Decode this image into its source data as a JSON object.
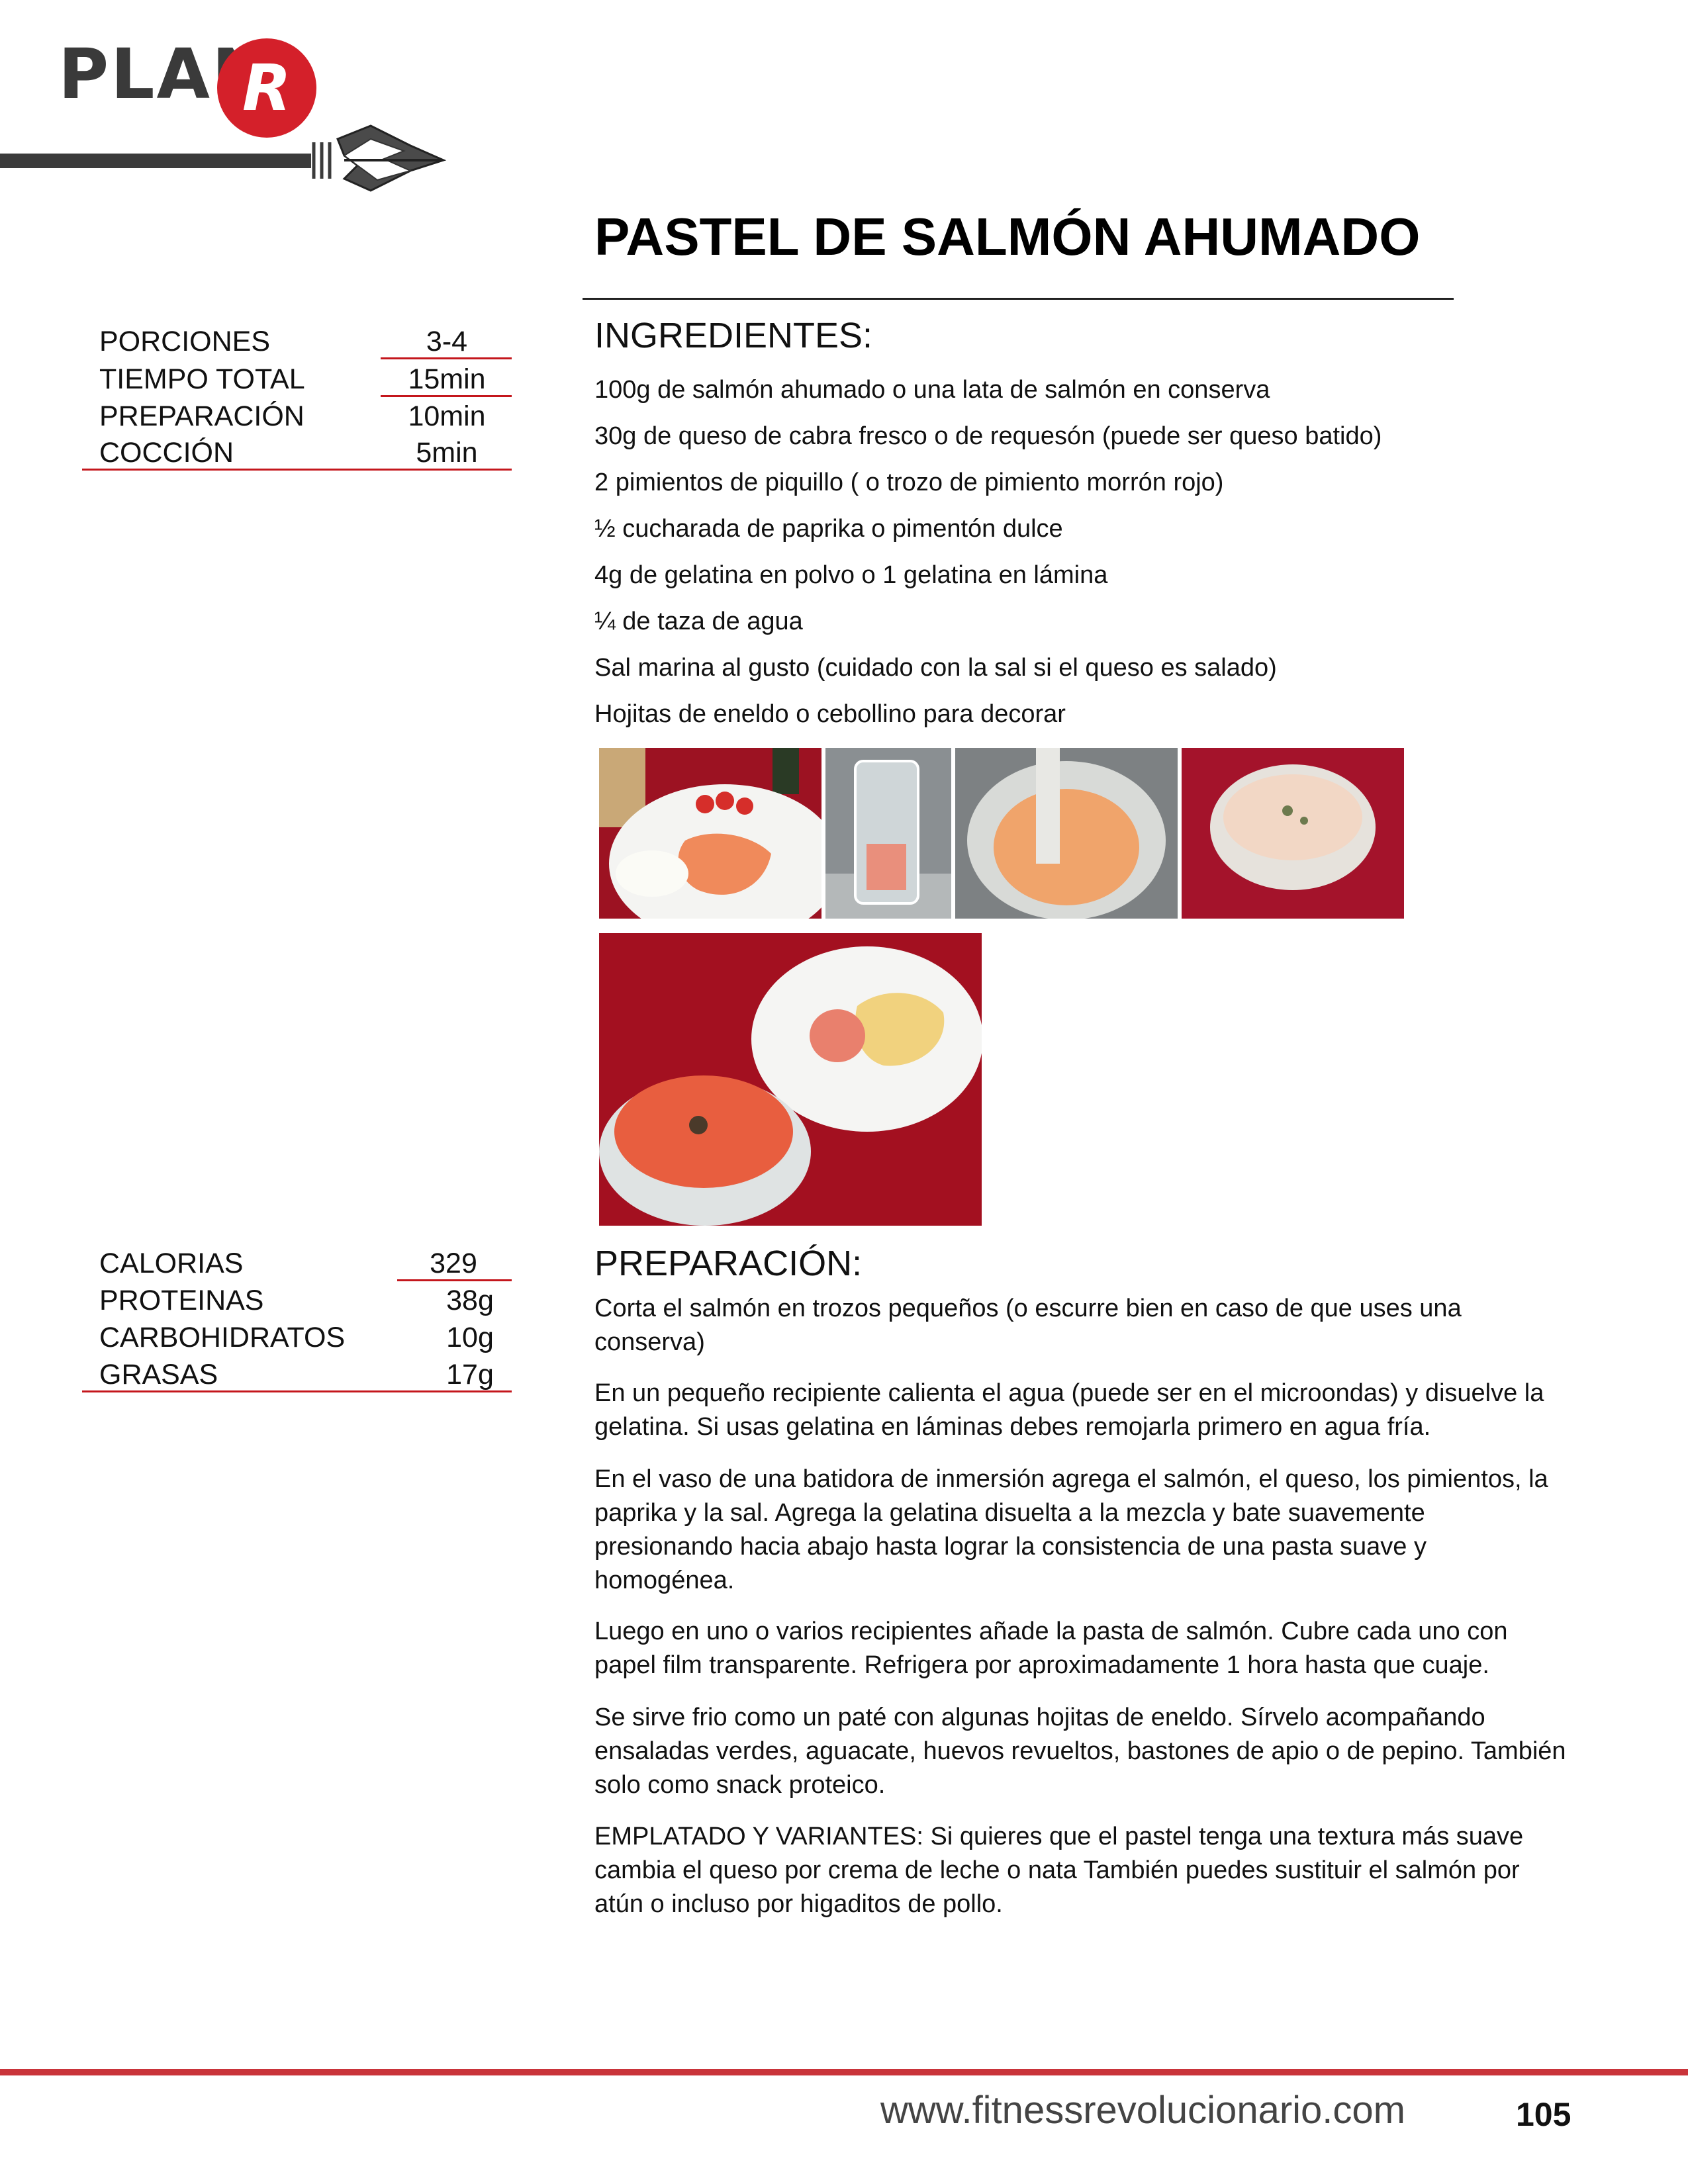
{
  "logo": {
    "word": "PLAN",
    "letter": "R"
  },
  "title": "PASTEL DE SALMÓN AHUMADO",
  "ingredients_heading": "INGREDIENTES:",
  "ingredients": [
    "100g de salmón ahumado o una lata de salmón en conserva",
    "30g de queso de cabra fresco o de requesón (puede ser queso batido)",
    "2 pimientos de piquillo ( o trozo de pimiento morrón rojo)",
    "½ cucharada de paprika o pimentón dulce",
    "4g de gelatina en polvo o 1 gelatina en lámina",
    "¼  de taza de agua",
    "Sal marina al gusto  (cuidado con la sal si el queso es salado)",
    "Hojitas de eneldo o cebollino para decorar"
  ],
  "recipe_info": [
    {
      "label": "PORCIONES",
      "value": "3-4"
    },
    {
      "label": "TIEMPO TOTAL",
      "value": "15min"
    },
    {
      "label": "PREPARACIÓN",
      "value": "10min"
    },
    {
      "label": "COCCIÓN",
      "value": "5min"
    }
  ],
  "nutrition": [
    {
      "label": "CALORIAS",
      "value": "329"
    },
    {
      "label": "PROTEINAS",
      "value": "38g"
    },
    {
      "label": "CARBOHIDRATOS",
      "value": "10g"
    },
    {
      "label": "GRASAS",
      "value": "17g"
    }
  ],
  "preparation_heading": "PREPARACIÓN:",
  "preparation": [
    "Corta el salmón en trozos pequeños (o escurre bien en caso de que uses una conserva)",
    "En un pequeño recipiente calienta el agua (puede ser en el microondas) y disuelve la gelatina.  Si usas gelatina en láminas debes remojarla primero  en agua fría.",
    "En el vaso de una batidora de inmersión agrega el salmón, el queso, los pimientos, la paprika y la sal. Agrega la gelatina disuelta a la mezcla y bate suavemente presionando hacia abajo hasta lograr la consistencia de una pasta suave y homogénea.",
    "Luego en uno o varios recipientes añade la pasta de salmón. Cubre cada uno con papel film transparente. Refrigera por aproximadamente 1 hora hasta que cuaje.",
    "Se sirve frio como un paté con algunas hojitas de eneldo. Sírvelo acompañando ensaladas verdes, aguacate, huevos  revueltos, bastones de apio o de pepino. También solo como snack proteico.",
    "EMPLATADO Y VARIANTES: Si quieres que el pastel tenga una textura más suave cambia el queso por crema de leche o nata También puedes sustituir el salmón por atún o incluso por higaditos de pollo."
  ],
  "footer": {
    "url": "www.fitnessrevolucionario.com",
    "page": "105"
  },
  "colors": {
    "accent_red": "#c4161c",
    "logo_red": "#d4202a",
    "logo_dark": "#3a3a3a"
  }
}
